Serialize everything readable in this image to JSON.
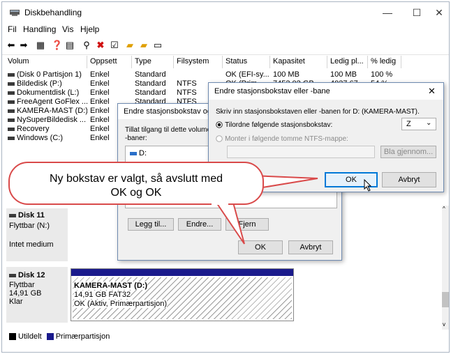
{
  "window": {
    "title": "Diskbehandling",
    "minimize": "—",
    "maximize": "☐",
    "close": "✕"
  },
  "menu": [
    "Fil",
    "Handling",
    "Vis",
    "Hjelp"
  ],
  "columns": [
    "Volum",
    "Oppsett",
    "Type",
    "Filsystem",
    "Status",
    "Kapasitet",
    "Ledig pl...",
    "% ledig"
  ],
  "volumes": [
    [
      "(Disk 0 Partisjon 1)",
      "Enkel",
      "Standard",
      "",
      "OK (EFI-sy...",
      "100 MB",
      "100 MB",
      "100 %"
    ],
    [
      "Bildedisk (P:)",
      "Enkel",
      "Standard",
      "NTFS",
      "OK (Prim...",
      "7452,02 GB",
      "4027,67...",
      "54 %"
    ],
    [
      "Dokumentdisk (L:)",
      "Enkel",
      "Standard",
      "NTFS",
      "",
      "",
      "",
      ""
    ],
    [
      "FreeAgent GoFlex ...",
      "Enkel",
      "Standard",
      "NTFS",
      "",
      "",
      "",
      ""
    ],
    [
      "KAMERA-MAST (D:)",
      "Enkel",
      "",
      "",
      "",
      "",
      "",
      ""
    ],
    [
      "NySuperBildedisk ...",
      "Enkel",
      "",
      "",
      "",
      "",
      "",
      ""
    ],
    [
      "Recovery",
      "Enkel",
      "",
      "",
      "",
      "",
      "",
      ""
    ],
    [
      "Windows (C:)",
      "Enkel",
      "",
      "",
      "",
      "",
      "",
      ""
    ]
  ],
  "disk11": {
    "name": "Disk 11",
    "type": "Flyttbar (N:)",
    "media": "Intet medium"
  },
  "disk12": {
    "name": "Disk 12",
    "type": "Flyttbar",
    "size": "14,91 GB",
    "status": "Klar",
    "partition_name": "KAMERA-MAST  (D:)",
    "partition_size": "14,91 GB FAT32",
    "partition_status": "OK (Aktiv, Primærpartisjon)"
  },
  "legend": {
    "unallocated": "Utildelt",
    "primary": "Primærpartisjon",
    "unallocated_color": "#000000",
    "primary_color": "#1a1a8c"
  },
  "dialog_back": {
    "title": "Endre stasjonsbokstav og -",
    "desc_line1": "Tillat tilgang til dette volumet v",
    "desc_line2": "-baner:",
    "list_item": "D:",
    "add": "Legg til...",
    "change": "Endre...",
    "remove": "Fjern",
    "ok": "OK",
    "cancel": "Avbryt"
  },
  "dialog_front": {
    "title": "Endre stasjonsbokstav eller -bane",
    "close": "✕",
    "instruction": "Skriv inn stasjonsbokstaven eller -banen for D: (KAMERA-MAST).",
    "radio_assign": "Tilordne følgende stasjonsbokstav:",
    "radio_mount": "Monter i følgende tomme NTFS-mappe:",
    "drive_letter": "Z",
    "browse": "Bla gjennom...",
    "ok": "OK",
    "cancel": "Avbryt"
  },
  "callout": {
    "line1": "Ny bokstav er valgt, så avslutt med",
    "line2": "OK og OK"
  },
  "colors": {
    "accent": "#0078d7",
    "callout_border": "#d94a4a",
    "partition_header": "#1a1a8c"
  }
}
